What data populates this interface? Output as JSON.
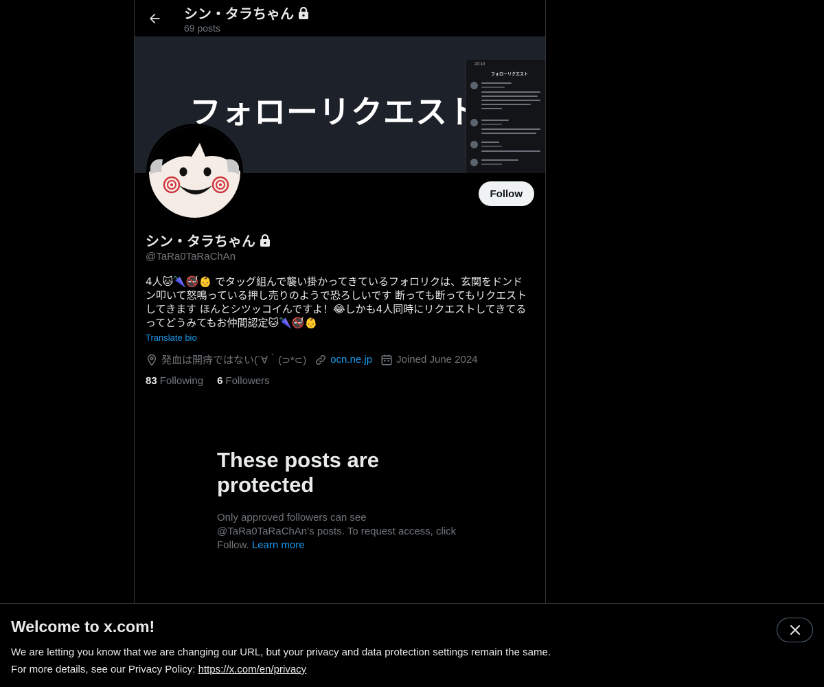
{
  "header": {
    "name": "シン・タラちゃん",
    "posts_count": "69 posts"
  },
  "banner": {
    "title": "フォローリクエスト",
    "phone_time": "20:10",
    "phone_heading": "フォローリクエスト"
  },
  "profile": {
    "name": "シン・タラちゃん",
    "handle": "@TaRa0TaRaChAn",
    "follow_label": "Follow",
    "bio": "4人🐱🌂🚭👶 でタッグ組んで襲い掛かってきているフォロリクは、玄関をドンドン叩いて怒鳴っている押し売りのようで恐ろしいです 断っても断ってもリクエストしてきます ほんとシツッコイんですよ！😂しかも4人同時にリクエストしてきてるってどうみてもお仲間認定🐱🌂🚭👶",
    "translate_label": "Translate bio",
    "location": "発血は開痔ではない(´∀｀(⊃*⊂)",
    "website": "ocn.ne.jp",
    "joined": "Joined June 2024",
    "following_count": "83",
    "following_label": "Following",
    "followers_count": "6",
    "followers_label": "Followers"
  },
  "protected": {
    "title": "These posts are protected",
    "text": "Only approved followers can see @TaRa0TaRaChAn’s posts. To request access, click Follow.",
    "learn_more": "Learn more"
  },
  "welcome": {
    "title": "Welcome to x.com!",
    "line1": "We are letting you know that we are changing our URL, but your privacy and data protection settings remain the same.",
    "line2_prefix": "For more details, see our Privacy Policy:",
    "privacy_link": "https://x.com/en/privacy"
  },
  "colors": {
    "accent": "#1d9bf0",
    "background": "#000000",
    "secondary_text": "#71767b",
    "border": "#2f3336"
  },
  "icons": [
    "back-arrow-icon",
    "lock-icon",
    "location-icon",
    "link-icon",
    "calendar-icon",
    "close-icon"
  ]
}
